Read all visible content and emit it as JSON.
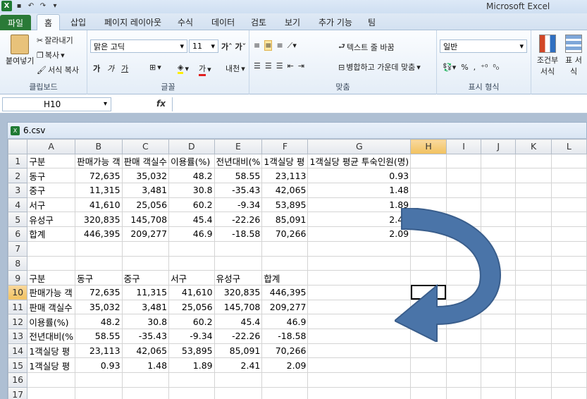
{
  "app": {
    "title": "Microsoft Excel"
  },
  "tabs": [
    "파일",
    "홈",
    "삽입",
    "페이지 레이아웃",
    "수식",
    "데이터",
    "검토",
    "보기",
    "추가 기능",
    "팀"
  ],
  "ribbon": {
    "clipboard": {
      "paste": "붙여넣기",
      "cut": "잘라내기",
      "copy": "복사",
      "format_painter": "서식 복사",
      "label": "클립보드"
    },
    "font": {
      "name": "맑은 고딕",
      "size": "11",
      "label": "글꼴",
      "bold": "가",
      "italic": "가",
      "underline": "가"
    },
    "align": {
      "wrap": "텍스트 줄 바꿈",
      "merge": "병합하고 가운데 맞춤",
      "label": "맞춤"
    },
    "number": {
      "format": "일반",
      "label": "표시 형식"
    },
    "styles": {
      "conditional": "조건부 서식",
      "table": "표 서식"
    }
  },
  "formula_bar": {
    "name_box": "H10",
    "fx": "fx",
    "value": ""
  },
  "workbook": {
    "name": "6.csv"
  },
  "columns": [
    "A",
    "B",
    "C",
    "D",
    "E",
    "F",
    "G",
    "H",
    "I",
    "J",
    "K",
    "L"
  ],
  "rows": [
    [
      "1",
      [
        "구분",
        "판매가능 객",
        "판매 객실수",
        "이용률(%)",
        "전년대비(%",
        "1객실당 평",
        "1객실당 평균 투숙인원(명)",
        "",
        "",
        "",
        "",
        ""
      ]
    ],
    [
      "2",
      [
        "동구",
        "72,635",
        "35,032",
        "48.2",
        "58.55",
        "23,113",
        "0.93",
        "",
        "",
        "",
        "",
        ""
      ]
    ],
    [
      "3",
      [
        "중구",
        "11,315",
        "3,481",
        "30.8",
        "-35.43",
        "42,065",
        "1.48",
        "",
        "",
        "",
        "",
        ""
      ]
    ],
    [
      "4",
      [
        "서구",
        "41,610",
        "25,056",
        "60.2",
        "-9.34",
        "53,895",
        "1.89",
        "",
        "",
        "",
        "",
        ""
      ]
    ],
    [
      "5",
      [
        "유성구",
        "320,835",
        "145,708",
        "45.4",
        "-22.26",
        "85,091",
        "2.41",
        "",
        "",
        "",
        "",
        ""
      ]
    ],
    [
      "6",
      [
        "합계",
        "446,395",
        "209,277",
        "46.9",
        "-18.58",
        "70,266",
        "2.09",
        "",
        "",
        "",
        "",
        ""
      ]
    ],
    [
      "7",
      [
        "",
        "",
        "",
        "",
        "",
        "",
        "",
        "",
        "",
        "",
        "",
        ""
      ]
    ],
    [
      "8",
      [
        "",
        "",
        "",
        "",
        "",
        "",
        "",
        "",
        "",
        "",
        "",
        ""
      ]
    ],
    [
      "9",
      [
        "구분",
        "동구",
        "중구",
        "서구",
        "유성구",
        "합계",
        "",
        "",
        "",
        "",
        "",
        ""
      ]
    ],
    [
      "10",
      [
        "판매가능 객",
        "72,635",
        "11,315",
        "41,610",
        "320,835",
        "446,395",
        "",
        "",
        "",
        "",
        "",
        ""
      ]
    ],
    [
      "11",
      [
        "판매 객실수",
        "35,032",
        "3,481",
        "25,056",
        "145,708",
        "209,277",
        "",
        "",
        "",
        "",
        "",
        ""
      ]
    ],
    [
      "12",
      [
        "이용률(%)",
        "48.2",
        "30.8",
        "60.2",
        "45.4",
        "46.9",
        "",
        "",
        "",
        "",
        "",
        ""
      ]
    ],
    [
      "13",
      [
        "전년대비(%",
        "58.55",
        "-35.43",
        "-9.34",
        "-22.26",
        "-18.58",
        "",
        "",
        "",
        "",
        "",
        ""
      ]
    ],
    [
      "14",
      [
        "1객실당 평",
        "23,113",
        "42,065",
        "53,895",
        "85,091",
        "70,266",
        "",
        "",
        "",
        "",
        "",
        ""
      ]
    ],
    [
      "15",
      [
        "1객실당 평",
        "0.93",
        "1.48",
        "1.89",
        "2.41",
        "2.09",
        "",
        "",
        "",
        "",
        "",
        ""
      ]
    ],
    [
      "16",
      [
        "",
        "",
        "",
        "",
        "",
        "",
        "",
        "",
        "",
        "",
        "",
        ""
      ]
    ],
    [
      "17",
      [
        "",
        "",
        "",
        "",
        "",
        "",
        "",
        "",
        "",
        "",
        "",
        ""
      ]
    ]
  ],
  "colors": {
    "arrow": "#4a74a8",
    "file_tab": "#2a7a37",
    "selected_header": "#f1c15f"
  }
}
